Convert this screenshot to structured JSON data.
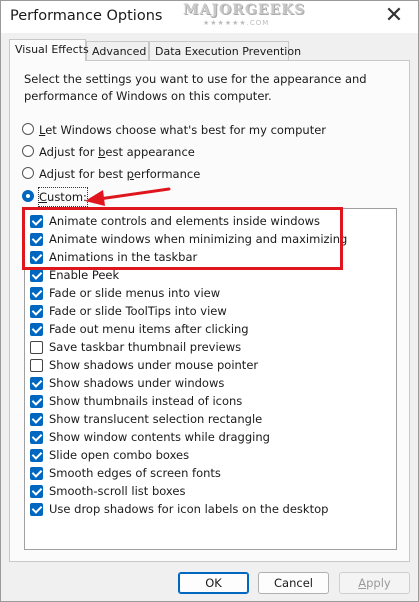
{
  "window": {
    "title": "Performance Options",
    "close_glyph": "✕"
  },
  "watermark": {
    "main": "MAJORGEEKS",
    "sub": "★★★★★★.COM"
  },
  "tabs": [
    {
      "label": "Visual Effects",
      "active": true
    },
    {
      "label": "Advanced",
      "active": false
    },
    {
      "label": "Data Execution Prevention",
      "active": false
    }
  ],
  "intro_text": "Select the settings you want to use for the appearance and performance of Windows on this computer.",
  "radio_options": [
    {
      "pre": "",
      "key": "L",
      "post": "et Windows choose what's best for my computer",
      "selected": false
    },
    {
      "pre": "Adjust for ",
      "key": "b",
      "post": "est appearance",
      "selected": false
    },
    {
      "pre": "Adjust for best ",
      "key": "p",
      "post": "erformance",
      "selected": false
    },
    {
      "pre": "",
      "key": "C",
      "post": "ustom:",
      "selected": true
    }
  ],
  "effects": [
    {
      "label": "Animate controls and elements inside windows",
      "checked": true
    },
    {
      "label": "Animate windows when minimizing and maximizing",
      "checked": true
    },
    {
      "label": "Animations in the taskbar",
      "checked": true
    },
    {
      "label": "Enable Peek",
      "checked": true
    },
    {
      "label": "Fade or slide menus into view",
      "checked": true
    },
    {
      "label": "Fade or slide ToolTips into view",
      "checked": true
    },
    {
      "label": "Fade out menu items after clicking",
      "checked": true
    },
    {
      "label": "Save taskbar thumbnail previews",
      "checked": false
    },
    {
      "label": "Show shadows under mouse pointer",
      "checked": false
    },
    {
      "label": "Show shadows under windows",
      "checked": true
    },
    {
      "label": "Show thumbnails instead of icons",
      "checked": true
    },
    {
      "label": "Show translucent selection rectangle",
      "checked": true
    },
    {
      "label": "Show window contents while dragging",
      "checked": true
    },
    {
      "label": "Slide open combo boxes",
      "checked": true
    },
    {
      "label": "Smooth edges of screen fonts",
      "checked": true
    },
    {
      "label": "Smooth-scroll list boxes",
      "checked": true
    },
    {
      "label": "Use drop shadows for icon labels on the desktop",
      "checked": true
    }
  ],
  "buttons": {
    "ok": "OK",
    "cancel": "Cancel",
    "apply_key": "A",
    "apply_rest": "pply"
  },
  "annotation": {
    "color": "#e0161f"
  },
  "accent_color": "#0067c0"
}
